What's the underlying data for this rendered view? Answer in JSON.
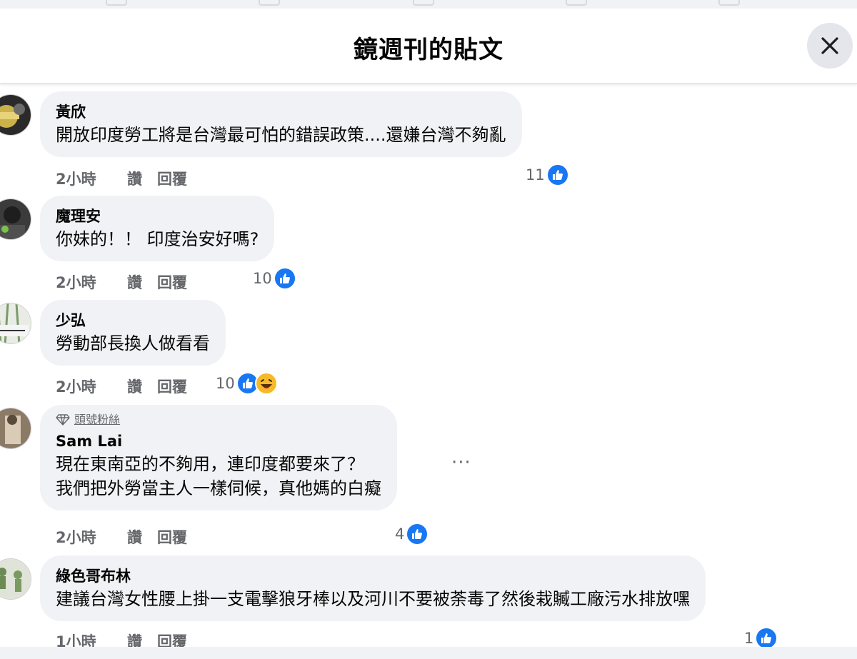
{
  "header": {
    "title": "鏡週刊的貼文"
  },
  "comments": [
    {
      "author": "黃欣",
      "text": "開放印度勞工將是台灣最可怕的錯誤政策....還嫌台灣不夠亂",
      "time": "2小時",
      "like_label": "讚",
      "reply_label": "回覆",
      "reaction_count": "11"
    },
    {
      "author": "魔理安",
      "text": "你妹的！！ 印度治安好嗎?",
      "time": "2小時",
      "like_label": "讚",
      "reply_label": "回覆",
      "reaction_count": "10"
    },
    {
      "author": "少弘",
      "text": "勞動部長換人做看看",
      "time": "2小時",
      "like_label": "讚",
      "reply_label": "回覆",
      "reaction_count": "10"
    },
    {
      "badge": "頭號粉絲",
      "author": "Sam Lai",
      "text_line1": "現在東南亞的不夠用，連印度都要來了？",
      "text_line2": "我們把外勞當主人一樣伺候，真他媽的白癡",
      "time": "2小時",
      "like_label": "讚",
      "reply_label": "回覆",
      "reaction_count": "4",
      "more_label": "···"
    },
    {
      "author": "綠色哥布林",
      "text": "建議台灣女性腰上掛一支電擊狼牙棒以及河川不要被荼毒了然後栽贓工廠污水排放嘿",
      "time": "1小時",
      "like_label": "讚",
      "reply_label": "回覆",
      "reaction_count": "1"
    }
  ],
  "colors": {
    "like_blue": "#1877f2",
    "bubble_bg": "#f0f2f5",
    "meta_gray": "#65676b"
  }
}
